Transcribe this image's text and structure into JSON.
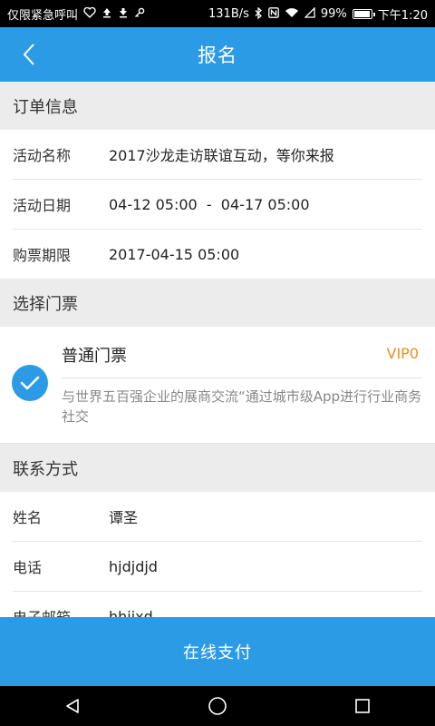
{
  "status_bar": {
    "left_text": "仅限紧急呼叫",
    "left_icons": [
      "heart-pulse-icon",
      "upload-icon",
      "download-icon",
      "key-icon"
    ],
    "speed": "131B/s",
    "battery": "99%",
    "battery_level": 0.99,
    "time": "下午1:20"
  },
  "app_bar": {
    "title": "报名"
  },
  "order_info": {
    "header": "订单信息",
    "rows": [
      {
        "label": "活动名称",
        "value": "2017沙龙走访联谊互动，等你来报"
      },
      {
        "label": "活动日期",
        "value": "04-12 05:00  -  04-17 05:00"
      },
      {
        "label": "购票期限",
        "value": "2017-04-15 05:00"
      }
    ]
  },
  "ticket_section": {
    "header": "选择门票",
    "ticket": {
      "name": "普通门票",
      "price": "VIP0",
      "description": "与世界五百强企业的展商交流“通过城市级App进行行业商务 社交",
      "selected": true
    }
  },
  "contact": {
    "header": "联系方式",
    "rows": [
      {
        "label": "姓名",
        "value": "谭圣"
      },
      {
        "label": "电话",
        "value": "hjdjdjd"
      },
      {
        "label": "电子邮箱",
        "value": "hhjjxd"
      }
    ]
  },
  "pay_button": {
    "label": "在线支付"
  },
  "colors": {
    "primary": "#2c9be5",
    "price": "#f08c1e"
  }
}
